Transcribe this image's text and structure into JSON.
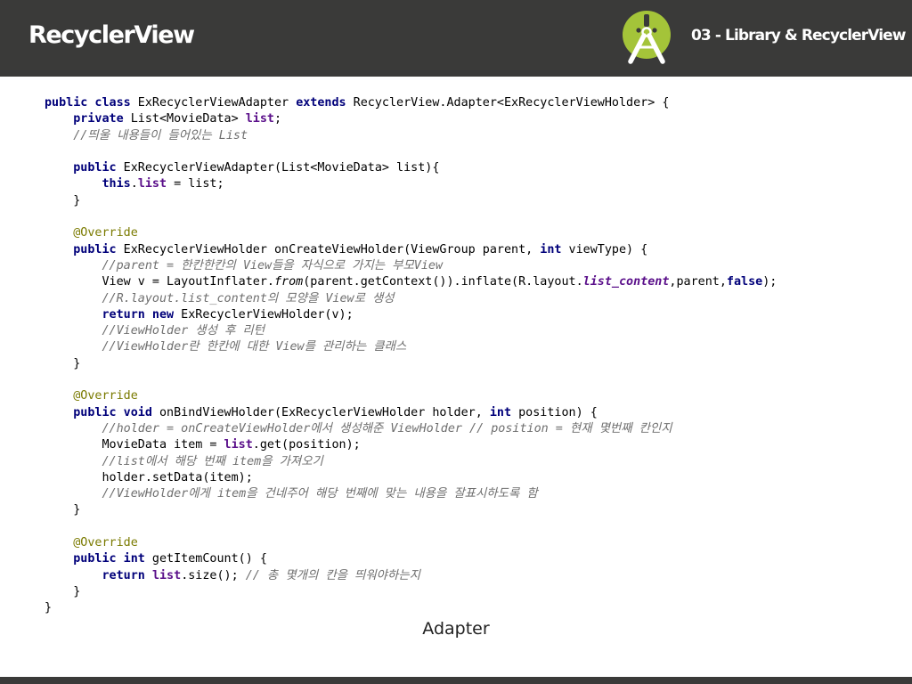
{
  "header": {
    "title": "RecyclerView",
    "section": "03 - Library & RecyclerView",
    "logo_icon": "android-studio-icon"
  },
  "code": {
    "lines": [
      [
        {
          "t": "public class",
          "k": "kw"
        },
        {
          "t": " ExRecyclerViewAdapter "
        },
        {
          "t": "extends",
          "k": "kw"
        },
        {
          "t": " RecyclerView.Adapter<ExRecyclerViewHolder> {"
        }
      ],
      [
        {
          "t": "    "
        },
        {
          "t": "private",
          "k": "kw"
        },
        {
          "t": " List<MovieData> "
        },
        {
          "t": "list",
          "k": "fld"
        },
        {
          "t": ";"
        }
      ],
      [
        {
          "t": "    "
        },
        {
          "t": "//띄울 내용들이 들어있는 List",
          "k": "cm"
        }
      ],
      [],
      [
        {
          "t": "    "
        },
        {
          "t": "public",
          "k": "kw"
        },
        {
          "t": " ExRecyclerViewAdapter(List<MovieData> list){"
        }
      ],
      [
        {
          "t": "        "
        },
        {
          "t": "this",
          "k": "kw"
        },
        {
          "t": "."
        },
        {
          "t": "list",
          "k": "fld"
        },
        {
          "t": " = list;"
        }
      ],
      [
        {
          "t": "    }"
        }
      ],
      [],
      [
        {
          "t": "    "
        },
        {
          "t": "@Override",
          "k": "ann"
        }
      ],
      [
        {
          "t": "    "
        },
        {
          "t": "public",
          "k": "kw"
        },
        {
          "t": " ExRecyclerViewHolder onCreateViewHolder(ViewGroup parent, "
        },
        {
          "t": "int",
          "k": "kw"
        },
        {
          "t": " viewType) {"
        }
      ],
      [
        {
          "t": "        "
        },
        {
          "t": "//parent = 한칸한칸의 View들을 자식으로 가지는 부모View",
          "k": "cm"
        }
      ],
      [
        {
          "t": "        View v = LayoutInflater."
        },
        {
          "t": "from",
          "k": "mth"
        },
        {
          "t": "(parent.getContext()).inflate(R.layout."
        },
        {
          "t": "list_content",
          "k": "fld-it"
        },
        {
          "t": ",parent,"
        },
        {
          "t": "false",
          "k": "kw"
        },
        {
          "t": ");"
        }
      ],
      [
        {
          "t": "        "
        },
        {
          "t": "//R.layout.list_content의 모양을 View로 생성",
          "k": "cm"
        }
      ],
      [
        {
          "t": "        "
        },
        {
          "t": "return new",
          "k": "kw"
        },
        {
          "t": " ExRecyclerViewHolder(v);"
        }
      ],
      [
        {
          "t": "        "
        },
        {
          "t": "//ViewHolder 생성 후 리턴",
          "k": "cm"
        }
      ],
      [
        {
          "t": "        "
        },
        {
          "t": "//ViewHolder란 한칸에 대한 View를 관리하는 클래스",
          "k": "cm"
        }
      ],
      [
        {
          "t": "    }"
        }
      ],
      [],
      [
        {
          "t": "    "
        },
        {
          "t": "@Override",
          "k": "ann"
        }
      ],
      [
        {
          "t": "    "
        },
        {
          "t": "public void",
          "k": "kw"
        },
        {
          "t": " onBindViewHolder(ExRecyclerViewHolder holder, "
        },
        {
          "t": "int",
          "k": "kw"
        },
        {
          "t": " position) {"
        }
      ],
      [
        {
          "t": "        "
        },
        {
          "t": "//holder = onCreateViewHolder에서 생성해준 ViewHolder // position = 현재 몇번째 칸인지",
          "k": "cm"
        }
      ],
      [
        {
          "t": "        MovieData item = "
        },
        {
          "t": "list",
          "k": "fld"
        },
        {
          "t": ".get(position);"
        }
      ],
      [
        {
          "t": "        "
        },
        {
          "t": "//list에서 해당 번째 item을 가져오기",
          "k": "cm"
        }
      ],
      [
        {
          "t": "        holder.setData(item);"
        }
      ],
      [
        {
          "t": "        "
        },
        {
          "t": "//ViewHolder에게 item을 건네주어 해당 번째에 맞는 내용을 잘표시하도록 함",
          "k": "cm"
        }
      ],
      [
        {
          "t": "    }"
        }
      ],
      [],
      [
        {
          "t": "    "
        },
        {
          "t": "@Override",
          "k": "ann"
        }
      ],
      [
        {
          "t": "    "
        },
        {
          "t": "public int",
          "k": "kw"
        },
        {
          "t": " getItemCount() {"
        }
      ],
      [
        {
          "t": "        "
        },
        {
          "t": "return",
          "k": "kw"
        },
        {
          "t": " "
        },
        {
          "t": "list",
          "k": "fld"
        },
        {
          "t": ".size(); "
        },
        {
          "t": "// 총 몇개의 칸을 띄워야하는지",
          "k": "cm"
        }
      ],
      [
        {
          "t": "    }"
        }
      ],
      [
        {
          "t": "}"
        }
      ]
    ]
  },
  "caption": "Adapter",
  "colors": {
    "header_bg": "#3a3a39",
    "keyword": "#00007a",
    "field": "#5a0f8a",
    "comment": "#6f6f6f",
    "annotation": "#7a7a00",
    "logo_green": "#a4c439"
  }
}
